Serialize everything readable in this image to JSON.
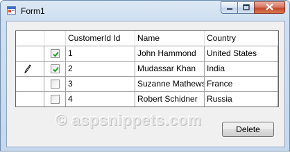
{
  "window": {
    "title": "Form1",
    "accent": "#0b63c4"
  },
  "grid": {
    "columns": [
      "",
      "CustomerId",
      "Id",
      "Name",
      "Country"
    ],
    "header_labels": {
      "checkbox": "",
      "customer_id": "CustomerId",
      "id": "Id",
      "name": "Name",
      "country": "Country"
    },
    "rows": [
      {
        "checked": true,
        "id": "1",
        "name": "John Hammond",
        "country": "United States",
        "editing": false
      },
      {
        "checked": true,
        "id": "2",
        "name": "Mudassar Khan",
        "country": "India",
        "editing": true
      },
      {
        "checked": false,
        "id": "3",
        "name": "Suzanne Mathews",
        "country": "France",
        "editing": false
      },
      {
        "checked": false,
        "id": "4",
        "name": "Robert Schidner",
        "country": "Russia",
        "editing": false
      }
    ]
  },
  "watermark": {
    "text": "© aspsnippets.com"
  },
  "buttons": {
    "delete_label": "Delete"
  },
  "icons": {
    "app": "form-app-icon",
    "edit_row": "pencil-icon",
    "minimize": "minimize-icon",
    "maximize": "maximize-icon",
    "close": "close-icon"
  }
}
